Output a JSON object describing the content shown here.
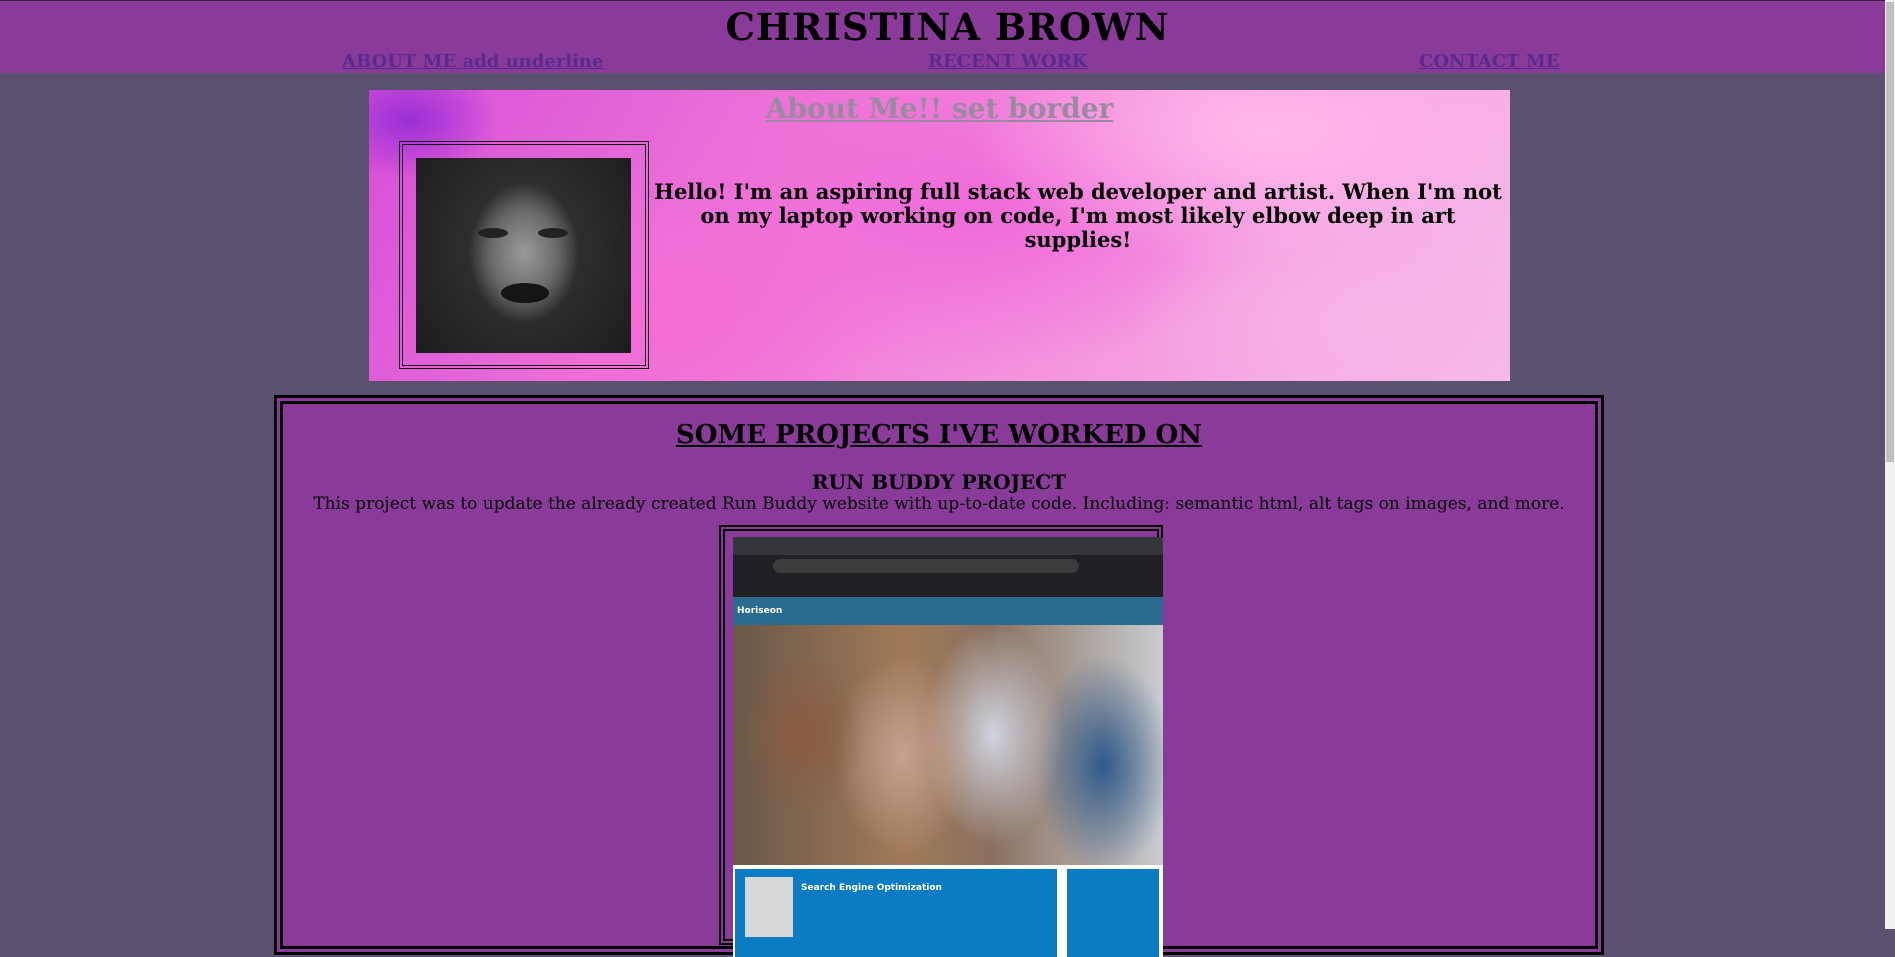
{
  "header": {
    "title": "CHRISTINA BROWN",
    "nav": [
      {
        "label": "ABOUT ME add underline"
      },
      {
        "label": "RECENT WORK"
      },
      {
        "label": "CONTACT ME"
      }
    ]
  },
  "about": {
    "title": "About Me!! set border",
    "text": "Hello! I'm an aspiring full stack web developer and artist. When I'm not on my laptop working on code, I'm most likely elbow deep in art supplies!"
  },
  "projects": {
    "title": "SOME PROJECTS I'VE WORKED ON",
    "items": [
      {
        "name": "RUN BUDDY PROJECT",
        "description": "This project was to update the already created Run Buddy website with up-to-date code. Including: semantic html, alt tags on images, and more.",
        "screenshot": {
          "site_name": "Horiseon",
          "section_heading": "Search Engine Optimization"
        }
      }
    ]
  },
  "colors": {
    "page_bg": "#5a5070",
    "header_bg": "#8a3b9a",
    "nav_link": "#5a2a8f",
    "about_title": "#9a8aa0"
  }
}
